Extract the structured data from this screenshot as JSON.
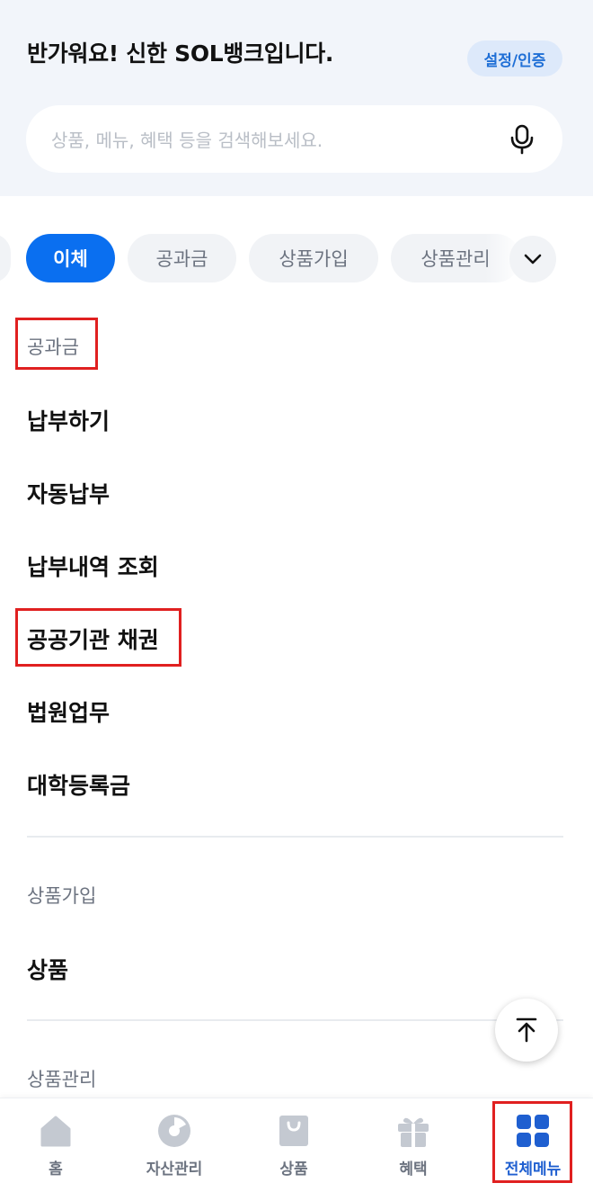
{
  "header": {
    "greeting": "반가워요! 신한 SOL뱅크입니다.",
    "auth_button": "설정/인증"
  },
  "search": {
    "placeholder": "상품, 메뉴, 혜택 등을 검색해보세요.",
    "icon": "microphone-icon"
  },
  "tabs": [
    {
      "label": "이체",
      "active": true
    },
    {
      "label": "공과금",
      "active": false
    },
    {
      "label": "상품가입",
      "active": false
    },
    {
      "label": "상품관리",
      "active": false
    }
  ],
  "tabs_more_icon": "chevron-down-icon",
  "sections": [
    {
      "title": "공과금",
      "items": [
        "납부하기",
        "자동납부",
        "납부내역 조회",
        "공공기관 채권",
        "법원업무",
        "대학등록금"
      ]
    },
    {
      "title": "상품가입",
      "items": [
        "상품"
      ]
    },
    {
      "title": "상품관리",
      "items": []
    }
  ],
  "scroll_top_icon": "arrow-up-icon",
  "bottom_nav": [
    {
      "label": "홈",
      "icon": "home-icon",
      "active": false
    },
    {
      "label": "자산관리",
      "icon": "pie-chart-icon",
      "active": false
    },
    {
      "label": "상품",
      "icon": "shopping-bag-icon",
      "active": false
    },
    {
      "label": "혜택",
      "icon": "gift-icon",
      "active": false
    },
    {
      "label": "전체메뉴",
      "icon": "grid-icon",
      "active": true
    }
  ],
  "colors": {
    "accent": "#0a6ff0",
    "header_bg": "#f2f5fa",
    "active_nav": "#1f5fd0",
    "highlight": "#e02020"
  }
}
